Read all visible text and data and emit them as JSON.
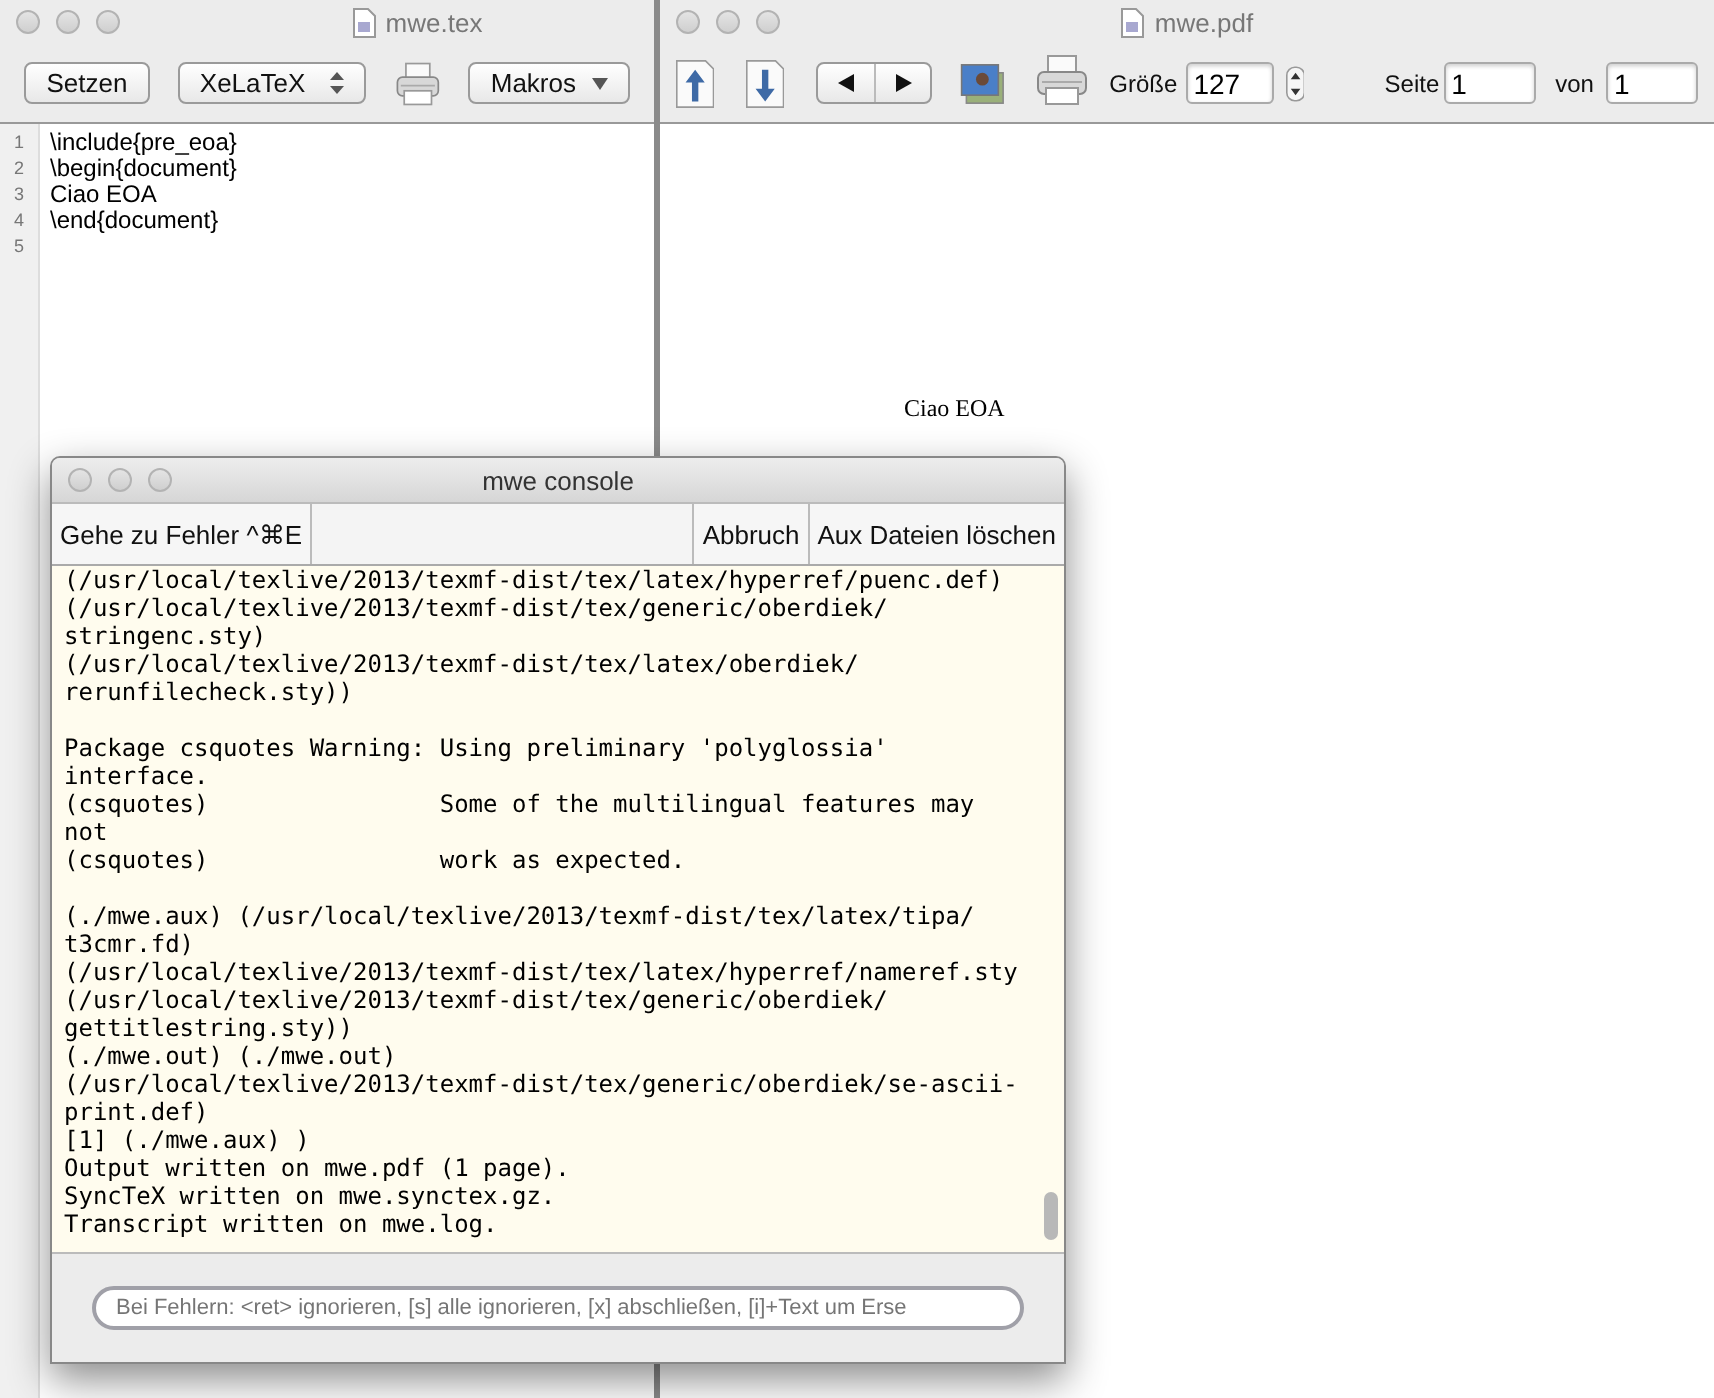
{
  "editor_window": {
    "title": "mwe.tex",
    "toolbar": {
      "typeset_button": "Setzen",
      "engine_popup": "XeLaTeX",
      "macros_popup": "Makros"
    },
    "lines": [
      {
        "number": "1",
        "text": "\\include{pre_eoa}"
      },
      {
        "number": "2",
        "text": "\\begin{document}"
      },
      {
        "number": "3",
        "text": "Ciao EOA"
      },
      {
        "number": "4",
        "text": "\\end{document}"
      },
      {
        "number": "5"
      }
    ]
  },
  "pdf_window": {
    "title": "mwe.pdf",
    "toolbar": {
      "size_label": "Größe",
      "size_value": "127",
      "page_label": "Seite",
      "page_value": "1",
      "of_label": "von",
      "of_value": "1"
    },
    "page_text": "Ciao EOA"
  },
  "console_window": {
    "title": "mwe console",
    "buttons": [
      "Gehe zu Fehler ^⌘E",
      "Abbruch",
      "Aux Dateien löschen"
    ],
    "log_blocks": [
      [
        "(/usr/local/texlive/2013/texmf-dist/tex/latex/hyperref/puenc.def)",
        "(/usr/local/texlive/2013/texmf-dist/tex/generic/oberdiek/",
        "stringenc.sty)",
        "(/usr/local/texlive/2013/texmf-dist/tex/latex/oberdiek/",
        "rerunfilecheck.sty))"
      ],
      [
        "Package csquotes Warning: Using preliminary 'polyglossia'",
        "interface.",
        "(csquotes)                Some of the multilingual features may",
        "not",
        "(csquotes)                work as expected."
      ],
      [
        "(./mwe.aux) (/usr/local/texlive/2013/texmf-dist/tex/latex/tipa/",
        "t3cmr.fd)",
        "(/usr/local/texlive/2013/texmf-dist/tex/latex/hyperref/nameref.sty",
        "(/usr/local/texlive/2013/texmf-dist/tex/generic/oberdiek/",
        "gettitlestring.sty))",
        "(./mwe.out) (./mwe.out)",
        "(/usr/local/texlive/2013/texmf-dist/tex/generic/oberdiek/se-ascii-",
        "print.def)",
        "[1] (./mwe.aux) )",
        "Output written on mwe.pdf (1 page).",
        "SyncTeX written on mwe.synctex.gz.",
        "Transcript written on mwe.log."
      ]
    ],
    "input_placeholder": "Bei Fehlern: <ret> ignorieren, [s] alle ignorieren, [x] abschließen, [i]+Text um Erse"
  }
}
